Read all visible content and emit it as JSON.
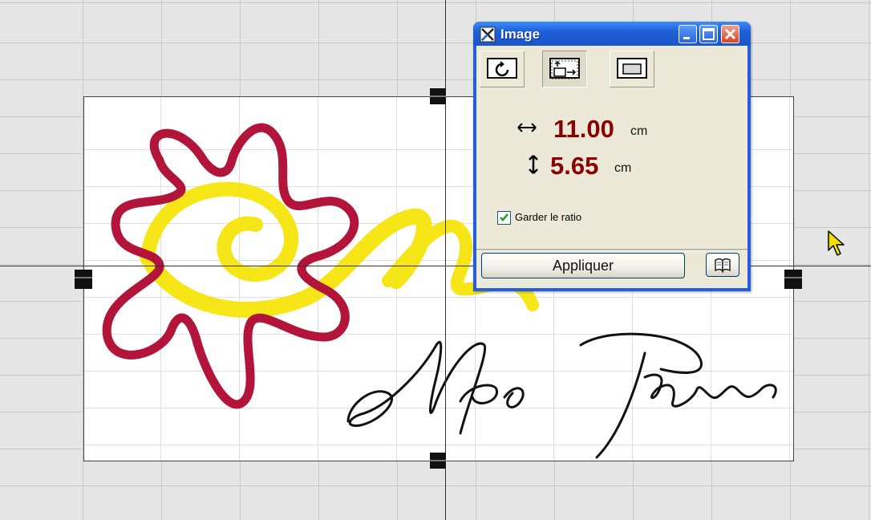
{
  "dialog": {
    "title": "Image",
    "tabs": [
      {
        "name": "rotate",
        "icon": "rotate-icon"
      },
      {
        "name": "resize",
        "icon": "resize-icon",
        "selected": true
      },
      {
        "name": "crop",
        "icon": "frame-icon"
      }
    ],
    "width_value": "11.00",
    "width_unit": "cm",
    "height_value": "5.65",
    "height_unit": "cm",
    "keep_ratio_label": "Garder le ratio",
    "keep_ratio_checked": true,
    "apply_label": "Appliquer",
    "help_icon": "book-icon"
  },
  "canvas": {
    "image_content": "logo with red flower outline, yellow swirl and handwritten signature",
    "signature_text": "Mas Figues"
  },
  "colors": {
    "title_bar": "#245edb",
    "dimension_value": "#8b0000",
    "dialog_body": "#ece9d8",
    "close_button": "#d9421f"
  }
}
